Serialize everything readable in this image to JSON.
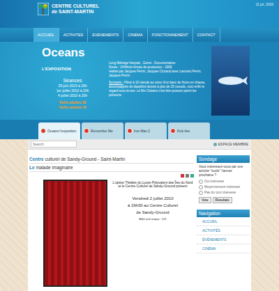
{
  "header": {
    "logo_line1": "CENTRE CULTUREL",
    "logo_line2": "de SAINT-MARTIN",
    "date": "11 jui, 2010"
  },
  "nav": [
    {
      "label": "ACCUEIL",
      "selected": true
    },
    {
      "label": "ACTIVITES",
      "selected": false
    },
    {
      "label": "EVENEMENTS",
      "selected": false
    },
    {
      "label": "CINEMA",
      "selected": false
    },
    {
      "label": "FONCTIONNEMENT",
      "selected": false
    },
    {
      "label": "CONTACT",
      "selected": false
    }
  ],
  "banner": {
    "title": "Oceans",
    "subtitle": "L'EXPOSITION",
    "seances_title": "Séances",
    "seances": [
      "29 juin 2010 à 20h",
      "1er juillet 2010 à 20h",
      "4 juillet 2010 à 20h"
    ],
    "prices": [
      "Tarifs adultes 6€",
      "Tarifs enfants 4€"
    ],
    "info": [
      "Long-Métrage français , Genre : Documentaires",
      "Durée : 1H44min Année de production : 2009",
      "réalisé par Jacques Perrin, Jacques Cluzaud avec Lancelot Perrin, Jacques Perrin"
    ],
    "synopsis_label": "Synopsis :",
    "synopsis": "Filmé à 10 nœuds au cœur d'un banc de thons en chasse, accompagnés de dauphins lancés à plus de 25 noeuds, voici enfin le regard sous la mer. Le film Océans c'est être poisson parmi les poissons."
  },
  "tabs": [
    {
      "label": "Oceans l'exposition",
      "selected": true
    },
    {
      "label": "Remember Me",
      "selected": false
    },
    {
      "label": "Iron Man 2",
      "selected": false
    },
    {
      "label": "Kick Ass",
      "selected": false
    }
  ],
  "search": {
    "placeholder": "Search"
  },
  "member": "ESPACE MEMBRE",
  "article": {
    "heading_bold": "Centre",
    "heading_rest": "culturel de Sandy-Ground - Saint-Martin",
    "title_bold": "Le",
    "title_rest": "malade imaginaire",
    "intro": "L'option Théâtre du Lycée Polyvalent des Îles du Nord et le Centre Culturel de Sandy-Ground présent",
    "lines": [
      "Vendredi 2 juillet 2010",
      "à 19h30 au Centre Culturel",
      "de Sandy-Ground"
    ],
    "price": "Billet tarif unique : 12€"
  },
  "poll": {
    "title": "Sondage",
    "question": "Vous intéressez-vous par une activité \"école\" l'année prochaine ?",
    "options": [
      {
        "label": "Oui intéressé",
        "selected": false
      },
      {
        "label": "Moyennement intéressé",
        "selected": false
      },
      {
        "label": "Pas du tout intéressé",
        "selected": false
      }
    ],
    "buttons": [
      "Vote",
      "Résultats"
    ]
  },
  "navigation": {
    "title": "Navigation",
    "items": [
      "ACCUEIL",
      "ACTIVITÉS",
      "ÉVÉNEMENTS",
      "CINÉMA"
    ]
  }
}
